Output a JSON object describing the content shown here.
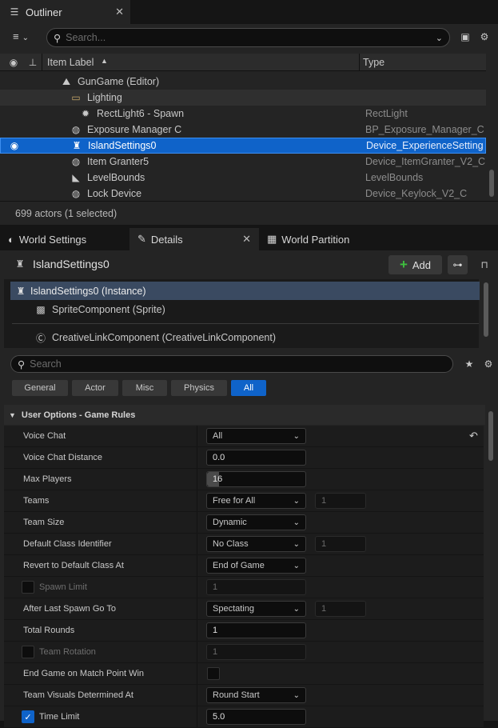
{
  "outliner": {
    "tab_title": "Outliner",
    "search_placeholder": "Search...",
    "col_item_label": "Item Label",
    "col_type": "Type",
    "rows": [
      {
        "label": "GunGame (Editor)",
        "type": "",
        "icon": "world-icon"
      },
      {
        "label": "Lighting",
        "type": "",
        "icon": "folder-icon"
      },
      {
        "label": "RectLight6 - Spawn",
        "type": "RectLight",
        "icon": "light-icon"
      },
      {
        "label": "Exposure Manager C",
        "type": "BP_Exposure_Manager_C",
        "icon": "device-icon"
      },
      {
        "label": "IslandSettings0",
        "type": "Device_ExperienceSetting",
        "icon": "island-settings-icon"
      },
      {
        "label": "Item Granter5",
        "type": "Device_ItemGranter_V2_C",
        "icon": "device-icon"
      },
      {
        "label": "LevelBounds",
        "type": "LevelBounds",
        "icon": "bounds-icon"
      },
      {
        "label": "Lock Device",
        "type": "Device_Keylock_V2_C",
        "icon": "device-icon"
      }
    ],
    "status": "699 actors (1 selected)"
  },
  "tabs": {
    "world_settings": "World Settings",
    "details": "Details",
    "world_partition": "World Partition"
  },
  "details": {
    "actor_name": "IslandSettings0",
    "add_label": "Add",
    "components": [
      {
        "label": "IslandSettings0 (Instance)"
      },
      {
        "label": "SpriteComponent (Sprite)"
      },
      {
        "label": "CreativeLinkComponent (CreativeLinkComponent)"
      }
    ],
    "search_placeholder": "Search",
    "filters": [
      "General",
      "Actor",
      "Misc",
      "Physics",
      "All"
    ],
    "active_filter": "All",
    "section_title": "User Options - Game Rules",
    "props": {
      "voice_chat": {
        "label": "Voice Chat",
        "value": "All"
      },
      "voice_chat_distance": {
        "label": "Voice Chat Distance",
        "value": "0.0"
      },
      "max_players": {
        "label": "Max Players",
        "value": "16",
        "fill": 0.12
      },
      "teams": {
        "label": "Teams",
        "value": "Free for All",
        "value2": "1"
      },
      "team_size": {
        "label": "Team Size",
        "value": "Dynamic"
      },
      "default_class_identifier": {
        "label": "Default Class Identifier",
        "value": "No Class",
        "value2": "1"
      },
      "revert_default_class": {
        "label": "Revert to Default Class At",
        "value": "End of Game"
      },
      "spawn_limit": {
        "label": "Spawn Limit",
        "value": "1"
      },
      "after_last_spawn": {
        "label": "After Last Spawn Go To",
        "value": "Spectating",
        "value2": "1"
      },
      "total_rounds": {
        "label": "Total Rounds",
        "value": "1"
      },
      "team_rotation": {
        "label": "Team Rotation",
        "value": "1"
      },
      "end_game_match_point": {
        "label": "End Game on Match Point Win"
      },
      "team_visuals": {
        "label": "Team Visuals Determined At",
        "value": "Round Start"
      },
      "time_limit": {
        "label": "Time Limit",
        "value": "5.0",
        "checked": true
      }
    }
  },
  "colors": {
    "selection": "#0f63c9",
    "accent_green": "#3fbf3f"
  }
}
